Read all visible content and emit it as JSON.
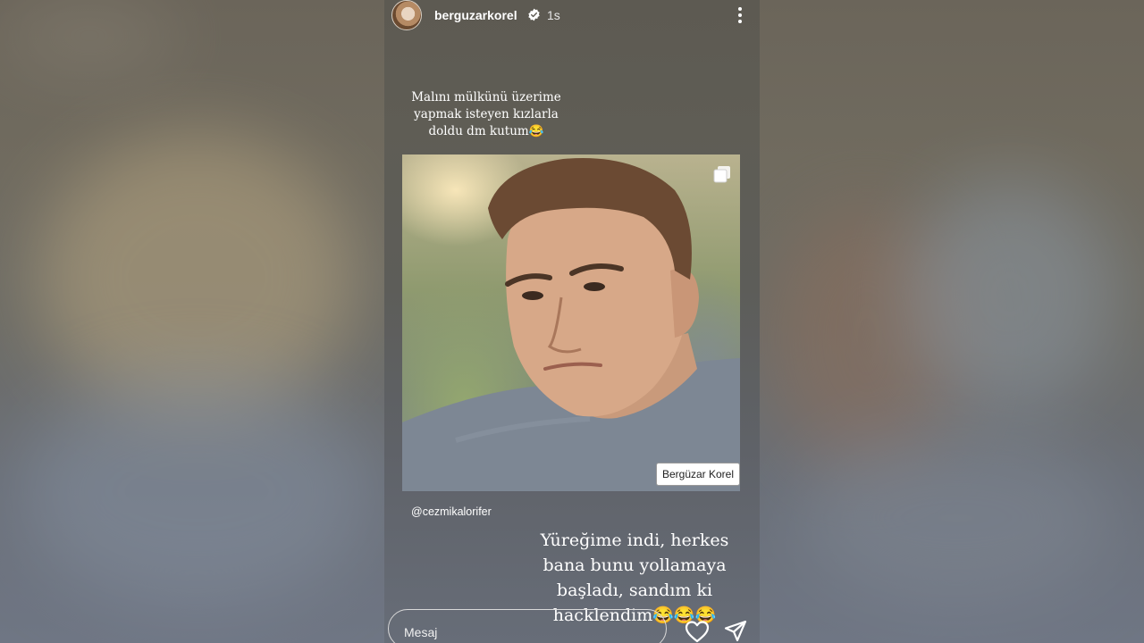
{
  "story": {
    "username": "berguzarkorel",
    "time": "1s",
    "caption_top": "Malını mülkünü üzerime\nyapmak isteyen kızlarla\ndoldu dm kutum😂",
    "watermark": "Bergüzar Korel",
    "mention": "@cezmikalorifer",
    "caption_bottom": "Yüreğime indi, herkes\nbana bunu yollamaya\nbaşladı, sandım ki\nhacklendim😂😂😂"
  },
  "reply": {
    "placeholder": "Mesaj"
  },
  "icons": {
    "verified": "verified-badge-icon",
    "more": "more-options-icon",
    "multi": "multiple-images-icon",
    "like": "heart-icon",
    "send": "send-icon"
  }
}
